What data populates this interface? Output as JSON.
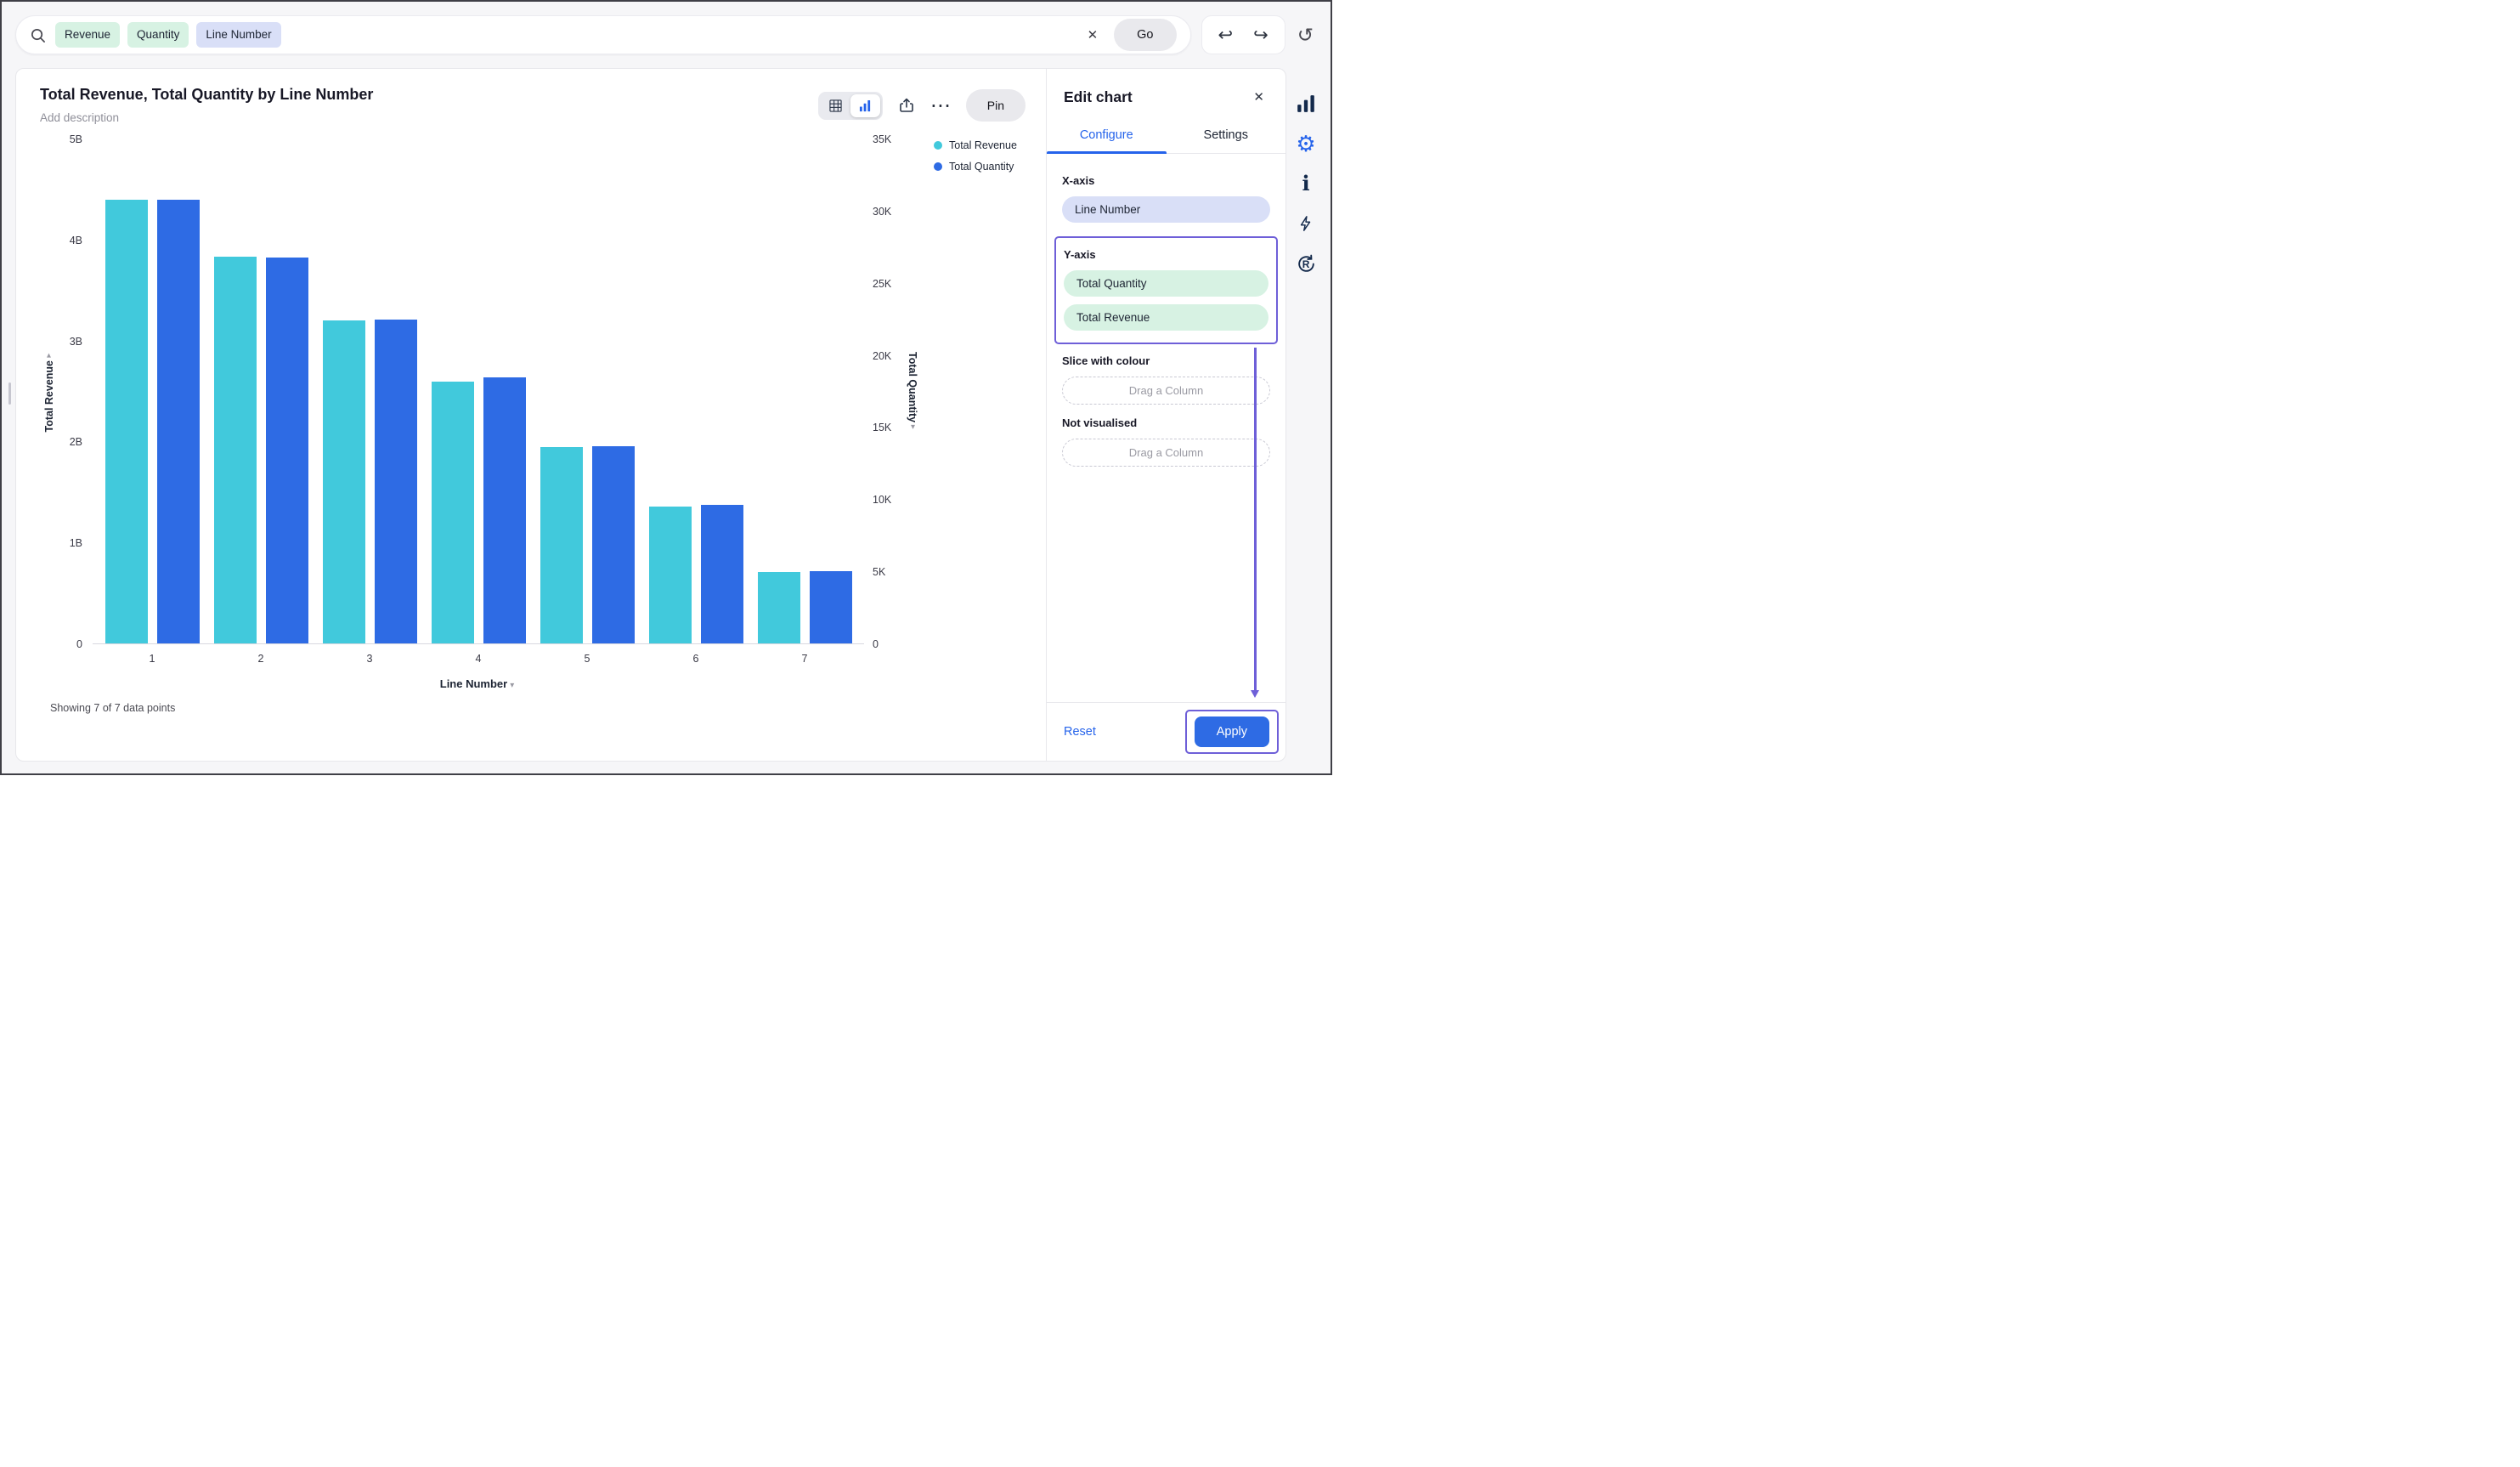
{
  "topbar": {
    "search_tokens": [
      {
        "label": "Revenue",
        "type": "measure"
      },
      {
        "label": "Quantity",
        "type": "measure"
      },
      {
        "label": "Line Number",
        "type": "dimension"
      }
    ],
    "go_label": "Go"
  },
  "header": {
    "title": "Total Revenue, Total Quantity by Line Number",
    "description_placeholder": "Add description",
    "pin_label": "Pin"
  },
  "chart_data": {
    "type": "bar",
    "title": "Total Revenue, Total Quantity by Line Number",
    "xlabel": "Line Number",
    "categories": [
      "1",
      "2",
      "3",
      "4",
      "5",
      "6",
      "7"
    ],
    "series": [
      {
        "name": "Total Revenue",
        "color": "#41c9dc",
        "axis": "left",
        "unit": "B",
        "axis_max": 5,
        "values": [
          4.4,
          3.84,
          3.2,
          2.6,
          1.95,
          1.36,
          0.71
        ]
      },
      {
        "name": "Total Quantity",
        "color": "#2e6be4",
        "axis": "right",
        "unit": "",
        "axis_max": 35000,
        "values": [
          30800,
          26800,
          22500,
          18500,
          13700,
          9600,
          5000
        ]
      }
    ],
    "left_axis": {
      "label": "Total Revenue",
      "ticks": [
        "5B",
        "4B",
        "3B",
        "2B",
        "1B",
        "0"
      ]
    },
    "right_axis": {
      "label": "Total Quantity",
      "ticks": [
        "35K",
        "30K",
        "25K",
        "20K",
        "15K",
        "10K",
        "5K",
        "0"
      ]
    },
    "legend_position": "top-right",
    "grid": false,
    "footer": "Showing 7 of 7 data points"
  },
  "edit_panel": {
    "title": "Edit chart",
    "tabs": [
      {
        "label": "Configure",
        "active": true
      },
      {
        "label": "Settings",
        "active": false
      }
    ],
    "x_axis": {
      "label": "X-axis",
      "value": "Line Number"
    },
    "y_axis": {
      "label": "Y-axis",
      "values": [
        "Total Quantity",
        "Total Revenue"
      ]
    },
    "slice": {
      "label": "Slice with colour",
      "placeholder": "Drag a Column"
    },
    "not_visualised": {
      "label": "Not visualised",
      "placeholder": "Drag a Column"
    },
    "reset_label": "Reset",
    "apply_label": "Apply"
  },
  "icons": {
    "clear": "✕",
    "close": "✕",
    "undo": "↩",
    "redo": "↪",
    "refresh": "↺",
    "more": "⋯",
    "caret_down": "▾",
    "gear": "⚙"
  },
  "colors": {
    "revenue_bar": "#41c9dc",
    "quantity_bar": "#2e6be4",
    "measure_chip_bg": "#d7f2e3",
    "dimension_chip_bg": "#d9dff7",
    "accent_blue": "#2563eb",
    "apply_blue": "#2e6be4",
    "annotation_purple": "#6e5fd8"
  }
}
